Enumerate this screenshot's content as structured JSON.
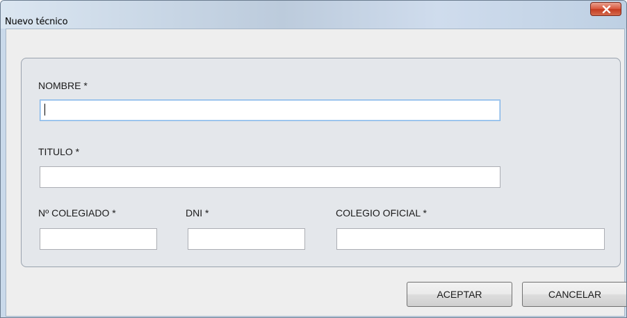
{
  "window": {
    "title": "Nuevo técnico",
    "close_icon": "close-icon"
  },
  "form": {
    "nombre": {
      "label": "NOMBRE *",
      "value": ""
    },
    "titulo": {
      "label": "TITULO *",
      "value": ""
    },
    "colegiado": {
      "label": "Nº COLEGIADO *",
      "value": ""
    },
    "dni": {
      "label": "DNI *",
      "value": ""
    },
    "colegio": {
      "label": "COLEGIO OFICIAL *",
      "value": ""
    }
  },
  "buttons": {
    "accept": "ACEPTAR",
    "cancel": "CANCELAR"
  },
  "colors": {
    "close_button": "#d9583f",
    "focus_border": "#7eb4ea"
  }
}
